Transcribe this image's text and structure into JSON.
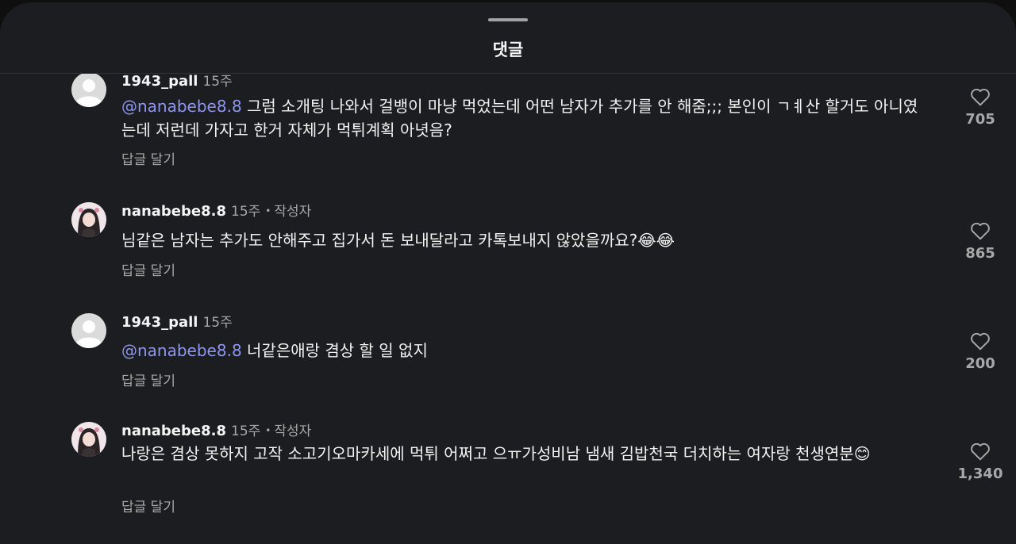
{
  "sheet": {
    "title": "댓글"
  },
  "comments": [
    {
      "username": "1943_pall",
      "time": "15주",
      "mention": "@nanabebe8.8",
      "text": " 그럼 소개팅 나와서 걸뱅이 마냥 먹었는데 어떤 남자가 추가를 안 해줌;;; 본인이 ㄱㅖ산 할거도 아니였는데 저런데 가자고 한거 자체가 먹튀계획 아녓음?",
      "reply_label": "답글 달기",
      "likes": "705",
      "avatar": "default-avatar"
    },
    {
      "username": "nanabebe8.8",
      "time": "15주",
      "author_badge": "작성자",
      "text": "님같은 남자는 추가도 안해주고 집가서 돈 보내달라고 카톡보내지 않았을까요?",
      "emoji": "😂😂",
      "reply_label": "답글 달기",
      "likes": "865",
      "avatar": "profile-photo"
    },
    {
      "username": "1943_pall",
      "time": "15주",
      "mention": "@nanabebe8.8",
      "text": " 너같은애랑 겸상 할 일 없지",
      "reply_label": "답글 달기",
      "likes": "200",
      "avatar": "default-avatar"
    },
    {
      "username": "nanabebe8.8",
      "time": "15주",
      "author_badge": "작성자",
      "text": "나랑은 겸상 못하지 고작 소고기오마카세에 먹튀 어쩌고 으ㅠ가성비남 냄새 김밥천국 더치하는 여자랑 천생연분",
      "emoji": "😊",
      "reply_label": "답글 달기",
      "likes": "1,340",
      "avatar": "profile-photo"
    }
  ],
  "icons": {
    "like": "heart-outline-icon",
    "default_avatar": "person-silhouette-icon"
  },
  "colors": {
    "background": "#1c1d21",
    "mention": "#8c96f0",
    "secondary_text": "#a8a8a8"
  }
}
